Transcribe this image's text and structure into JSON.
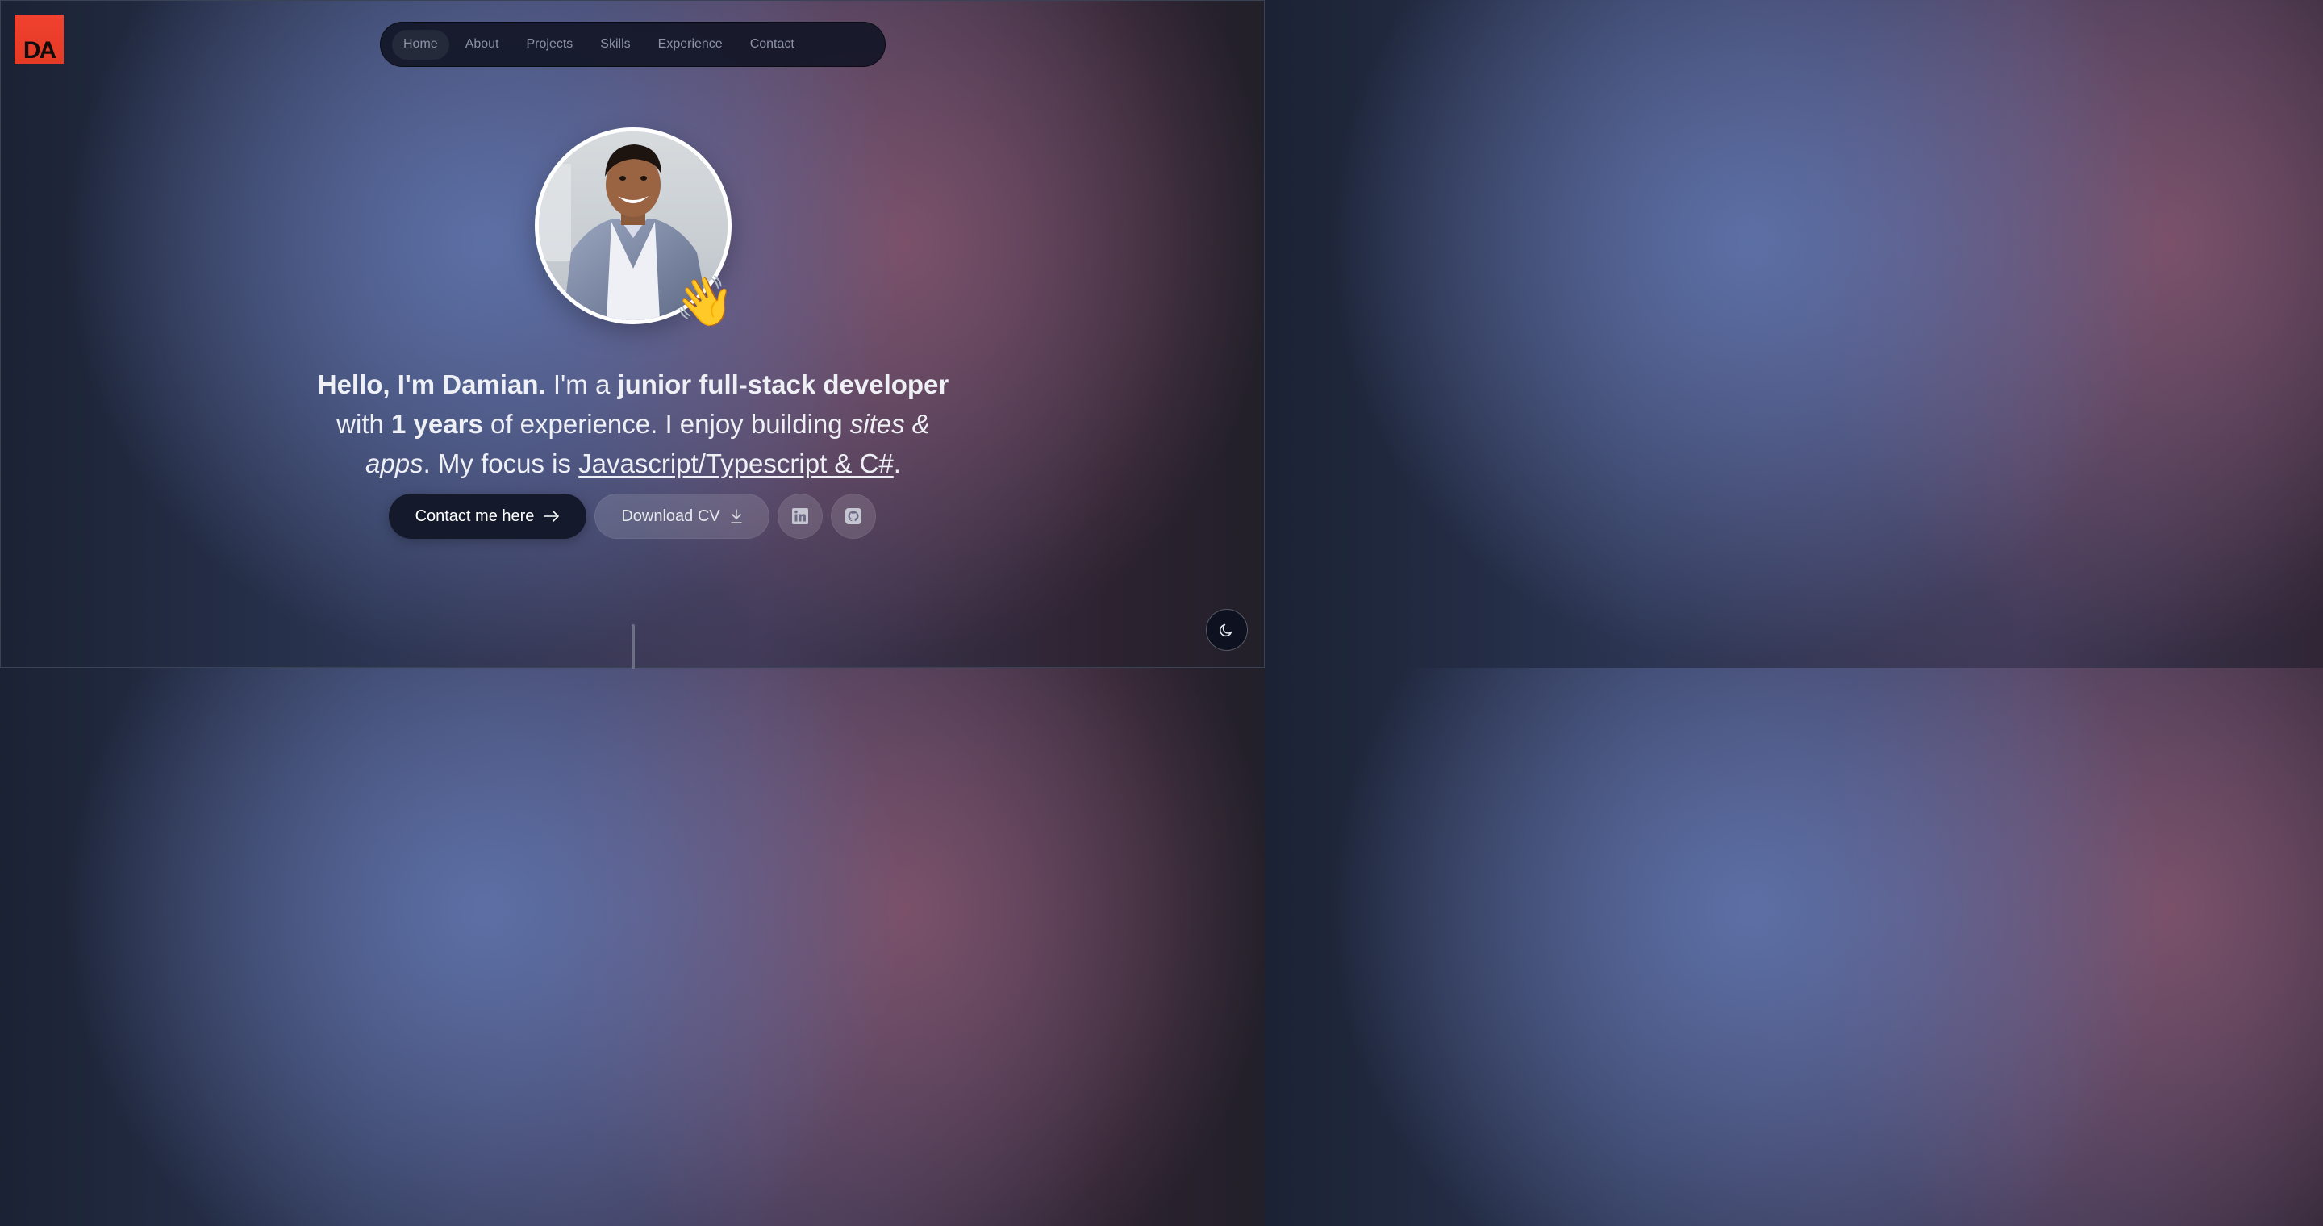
{
  "logo": {
    "text": "DA",
    "color": "#ee3f2b"
  },
  "nav": {
    "items": [
      {
        "label": "Home",
        "active": true
      },
      {
        "label": "About",
        "active": false
      },
      {
        "label": "Projects",
        "active": false
      },
      {
        "label": "Skills",
        "active": false
      },
      {
        "label": "Experience",
        "active": false
      },
      {
        "label": "Contact",
        "active": false
      }
    ]
  },
  "hero": {
    "avatar_alt": "profile-photo",
    "wave_emoji": "👋",
    "intro": {
      "part1_bold": "Hello, I'm Damian.",
      "part2": " I'm a ",
      "part3_bold": "junior full-stack developer",
      "part4": " with ",
      "part5_bold": "1 years",
      "part6": " of experience. I enjoy building ",
      "part7_italic": "sites & apps",
      "part8": ". My focus is ",
      "part9_underline": "Javascript/Typescript & C#",
      "part10": "."
    },
    "buttons": {
      "contact_label": "Contact me here",
      "download_label": "Download CV"
    }
  },
  "icons": {
    "contact": "arrow-right-icon",
    "download": "download-icon",
    "linkedin": "linkedin-icon",
    "github": "github-icon",
    "theme": "moon-icon"
  }
}
